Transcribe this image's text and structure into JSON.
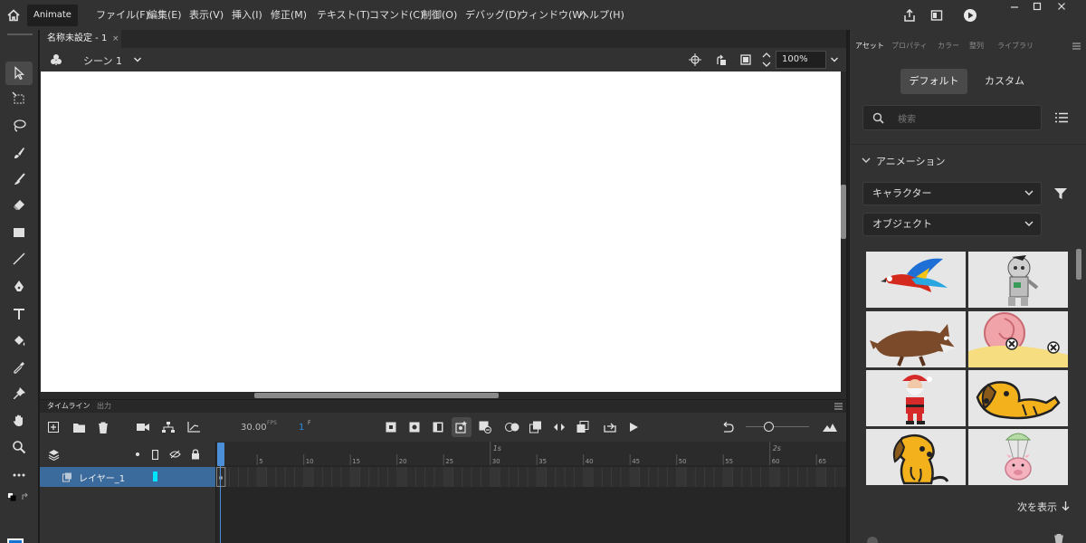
{
  "menubar": {
    "app_tab": "Animate",
    "items": [
      "ファイル(F)",
      "編集(E)",
      "表示(V)",
      "挿入(I)",
      "修正(M)",
      "テキスト(T)",
      "コマンド(C)",
      "制御(O)",
      "デバッグ(D)",
      "ウィンドウ(W)",
      "ヘルプ(H)"
    ]
  },
  "document": {
    "tab_title": "名称未設定 - 1",
    "scene": "シーン 1",
    "zoom": "100%"
  },
  "timeline": {
    "tabs": [
      "タイムライン",
      "出力"
    ],
    "fps": "30.00",
    "fps_unit": "FPS",
    "frame": "1",
    "frame_unit": "F",
    "layer_name": "レイヤー_1",
    "ruler_numbers": [
      "5",
      "10",
      "15",
      "20",
      "25",
      "30",
      "35",
      "40",
      "45",
      "50",
      "55",
      "60",
      "65"
    ],
    "second_marks": [
      "1s",
      "2s"
    ]
  },
  "panel": {
    "tabs": [
      "アセット",
      "プロパティ",
      "カラー",
      "整列",
      "ライブラリ"
    ],
    "toggle_default": "デフォルト",
    "toggle_custom": "カスタム",
    "search_placeholder": "検索",
    "section_title": "アニメーション",
    "filter1": "キャラクター",
    "filter2": "オブジェクト",
    "show_more": "次を表示",
    "thumbnails": [
      "parrot",
      "mummy",
      "wolf",
      "snail",
      "santa",
      "dog-lying",
      "dog-sitting",
      "pig-parachute"
    ]
  },
  "colors": {
    "accent": "#2d8ceb",
    "layer_selected": "#3b6b9c",
    "layer_color": "#00e5ff",
    "playhead": "#4a8fd8"
  }
}
